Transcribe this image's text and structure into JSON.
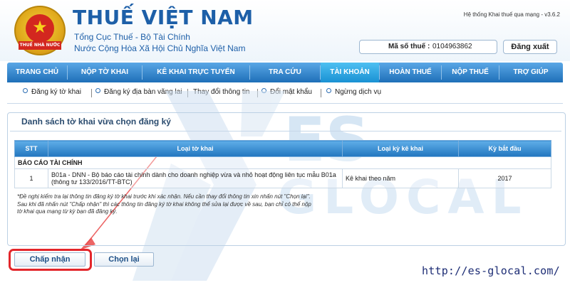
{
  "header": {
    "brand": "THUẾ VIỆT NAM",
    "subtitle1": "Tổng Cục Thuế - Bộ Tài Chính",
    "subtitle2": "Nước Cộng Hòa Xã Hội Chủ Nghĩa Việt Nam",
    "system_version": "Hệ thống Khai thuế qua mạng - v3.6.2",
    "tax_code_label": "Mã số thuế :",
    "tax_code_value": "0104963862",
    "logout_label": "Đăng xuất",
    "emblem_text": "THUẾ NHÀ NƯỚC",
    "emblem_icon": "star-icon"
  },
  "nav": {
    "items": [
      {
        "label": "TRANG CHỦ"
      },
      {
        "label": "NỘP TỜ KHAI"
      },
      {
        "label": "KÊ KHAI TRỰC TUYẾN"
      },
      {
        "label": "TRA CỨU"
      },
      {
        "label": "TÀI KHOẢN"
      },
      {
        "label": "HOÀN THUẾ"
      },
      {
        "label": "NỘP THUẾ"
      },
      {
        "label": "TRỢ GIÚP"
      }
    ],
    "active": "TÀI KHOẢN"
  },
  "subnav": {
    "items": [
      {
        "label": "Đăng ký tờ khai"
      },
      {
        "label": "Đăng ký địa bàn vãng lai"
      },
      {
        "label": "Thay đổi thông tin"
      },
      {
        "label": "Đổi mật khẩu"
      },
      {
        "label": "Ngừng dịch vụ"
      }
    ]
  },
  "panel": {
    "title": "Danh sách tờ khai vừa chọn đăng ký",
    "columns": [
      "STT",
      "Loại tờ khai",
      "Loại kỳ kê khai",
      "Kỳ bắt đầu"
    ],
    "group": "BÁO CÁO TÀI CHÍNH",
    "rows": [
      {
        "stt": "1",
        "form_line1": "B01a - DNN - Bộ báo cáo tài chính dành cho doanh nghiệp vừa và nhỏ hoạt động liên tục mẫu B01a",
        "form_line2": "(thông tư 133/2016/TT-BTC)",
        "period_type": "Kê khai theo năm",
        "start_period": "2017"
      }
    ],
    "note_line1": "*Đề nghị kiểm tra lại thông tin đăng ký tờ khai trước khi xác nhận. Nếu cần thay đổi thông tin xin nhấn nút \"Chọn lại\".",
    "note_line2": "Sau khi đã nhấn nút \"Chấp nhận\" thì các thông tin đăng ký tờ khai không thể sửa lại được về sau, bạn chỉ có thể nộp",
    "note_line3": "tờ khai qua mạng từ kỳ bạn đã đăng ký."
  },
  "actions": {
    "accept_label": "Chấp nhận",
    "reselect_label": "Chọn lại"
  },
  "watermark": {
    "brand_top": "ES",
    "brand_bottom": "GLOCAL",
    "url": "http://es-glocal.com/"
  },
  "colors": {
    "brand_blue": "#1d5fa8",
    "nav_blue": "#1e6fb8",
    "nav_active": "#1991d3",
    "highlight_red": "#e3262b",
    "watermark_blue": "#9fc3e6"
  }
}
